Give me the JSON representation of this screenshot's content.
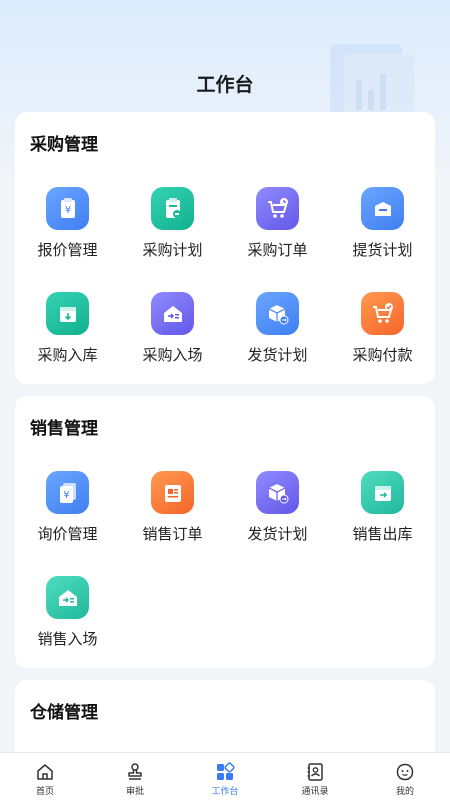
{
  "header": {
    "title": "工作台"
  },
  "sections": [
    {
      "title": "采购管理",
      "items": [
        {
          "label": "报价管理",
          "icon": "quote-icon",
          "color": "#4f8ef7"
        },
        {
          "label": "采购计划",
          "icon": "purchase-plan-icon",
          "color": "#17bc98"
        },
        {
          "label": "采购订单",
          "icon": "cart-clock-icon",
          "color": "#6c5ff0"
        },
        {
          "label": "提货计划",
          "icon": "pickup-box-icon",
          "color": "#4f8ef7"
        },
        {
          "label": "采购入库",
          "icon": "inbound-box-icon",
          "color": "#17bc98"
        },
        {
          "label": "采购入场",
          "icon": "entry-icon",
          "color": "#6c5ff0"
        },
        {
          "label": "发货计划",
          "icon": "shipping-box-icon",
          "color": "#4f8ef7"
        },
        {
          "label": "采购付款",
          "icon": "cart-check-icon",
          "color": "#f5702f"
        }
      ]
    },
    {
      "title": "销售管理",
      "items": [
        {
          "label": "询价管理",
          "icon": "inquiry-icon",
          "color": "#4f8ef7"
        },
        {
          "label": "销售订单",
          "icon": "sales-order-icon",
          "color": "#f5702f"
        },
        {
          "label": "发货计划",
          "icon": "shipping-box-icon",
          "color": "#6c5ff0"
        },
        {
          "label": "销售出库",
          "icon": "outbound-box-icon",
          "color": "#21b99c"
        },
        {
          "label": "销售入场",
          "icon": "entry-icon",
          "color": "#21b99c"
        }
      ]
    },
    {
      "title": "仓储管理",
      "items": []
    }
  ],
  "tabbar": {
    "active": 2,
    "tabs": [
      {
        "label": "首页",
        "icon": "home-icon"
      },
      {
        "label": "审批",
        "icon": "stamp-icon"
      },
      {
        "label": "工作台",
        "icon": "workbench-icon"
      },
      {
        "label": "通讯录",
        "icon": "contacts-icon"
      },
      {
        "label": "我的",
        "icon": "profile-icon"
      }
    ]
  }
}
